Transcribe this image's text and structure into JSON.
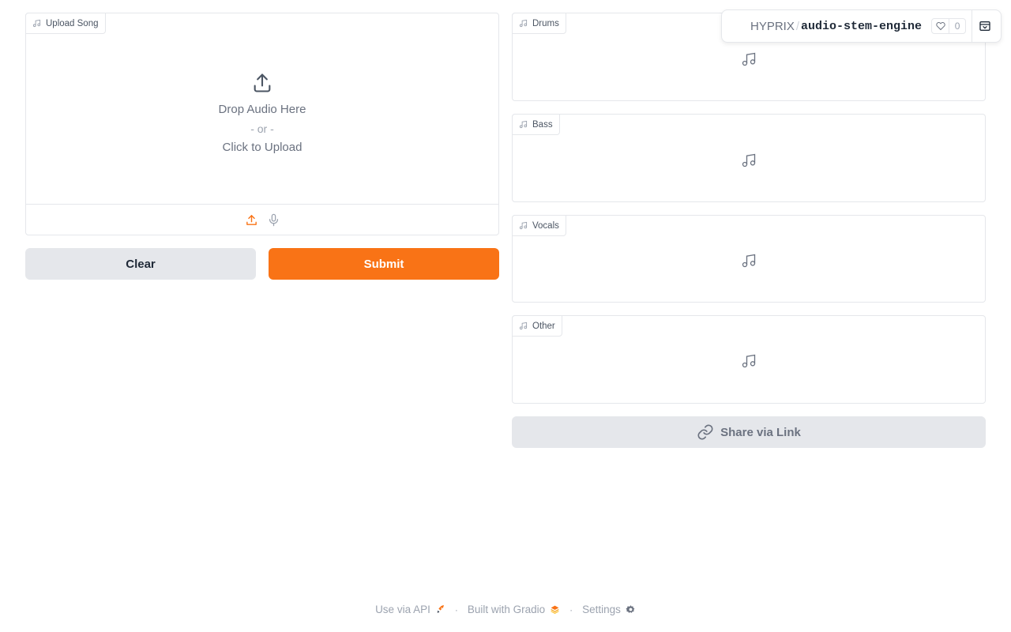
{
  "header": {
    "owner": "HYPRIX",
    "repo": "audio-stem-engine",
    "like_count": "0"
  },
  "upload": {
    "label": "Upload Song",
    "drop_text": "Drop Audio Here",
    "or_text": "- or -",
    "click_text": "Click to Upload"
  },
  "buttons": {
    "clear": "Clear",
    "submit": "Submit",
    "share": "Share via Link"
  },
  "stems": {
    "drums": "Drums",
    "bass": "Bass",
    "vocals": "Vocals",
    "other": "Other"
  },
  "footer": {
    "api": "Use via API",
    "built": "Built with Gradio",
    "settings": "Settings"
  },
  "colors": {
    "accent": "#f97316",
    "secondary_button": "#e5e7eb",
    "border": "#e5e7eb"
  }
}
